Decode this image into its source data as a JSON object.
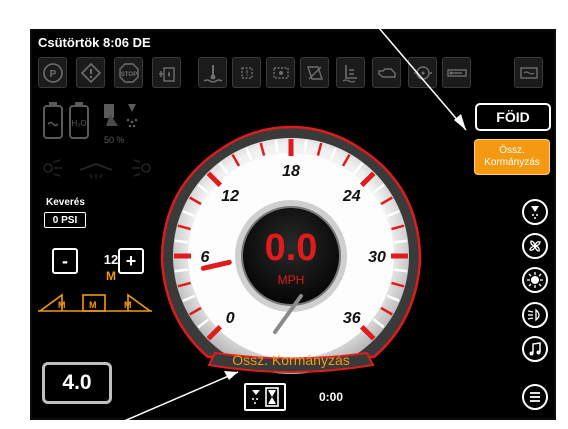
{
  "header": {
    "datetime": "Csütörtök 8:06 DE"
  },
  "warning_icons": [
    "parking-brake-icon",
    "warning-triangle-icon",
    "stop-icon",
    "fuel-filter-icon",
    "coolant-temp-icon",
    "engine-fault-icon",
    "transmission-icon",
    "filter-clogged-icon",
    "hydraulic-icon",
    "engine-oil-icon",
    "oil-pressure-icon",
    "battery-charge-icon",
    "def-icon"
  ],
  "status": {
    "fan_percent": "50 %"
  },
  "mode_buttons": {
    "foid_label": "FÖID",
    "assist_line1": "Össz.",
    "assist_line2": "Kormányzás"
  },
  "mixing": {
    "label": "Keverés",
    "pressure": "0 PSI"
  },
  "level_control": {
    "minus": "-",
    "plus": "+",
    "value": "12",
    "mode": "M",
    "modes": [
      "M",
      "M",
      "M"
    ]
  },
  "gear": {
    "value": "4.0"
  },
  "gauge": {
    "speed": "0.0",
    "unit": "MPH",
    "scale_labels": [
      "0",
      "6",
      "12",
      "18",
      "24",
      "30",
      "36"
    ],
    "min": 0,
    "max": 36,
    "status_text": "Össz. Kormányzás",
    "arc_color": "#e01b1b",
    "status_color": "#f39a12"
  },
  "timer": {
    "time": "0:00"
  },
  "side_buttons": [
    "spray-nozzle-icon",
    "fan-icon",
    "sun-icon",
    "headlight-icon",
    "music-icon",
    "menu-icon"
  ]
}
